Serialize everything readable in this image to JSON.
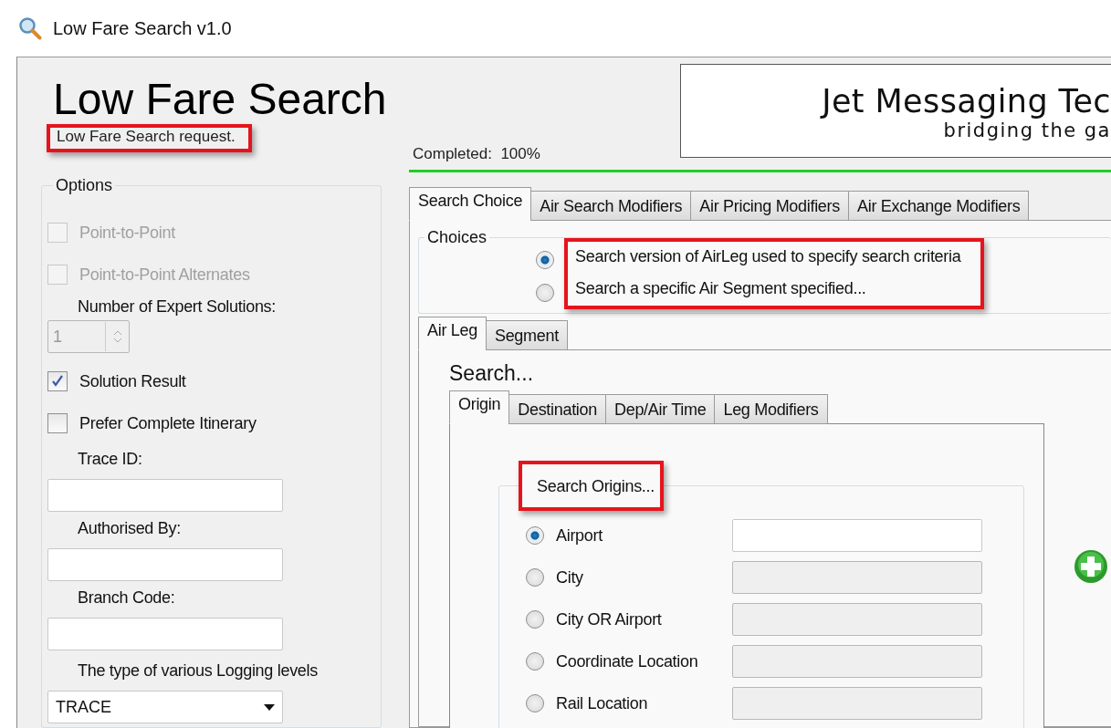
{
  "window": {
    "title": "Low Fare Search v1.0"
  },
  "header": {
    "title": "Low Fare Search",
    "subtitle": "Low Fare Search request.",
    "subtitle_highlighted": true
  },
  "options": {
    "legend": "Options",
    "items": [
      {
        "kind": "checkbox",
        "label": "Point-to-Point",
        "checked": false,
        "disabled": true
      },
      {
        "kind": "checkbox",
        "label": "Point-to-Point Alternates",
        "checked": false,
        "disabled": true
      },
      {
        "kind": "spinner",
        "label": "Number of Expert Solutions:",
        "value": "1",
        "disabled": true
      },
      {
        "kind": "checkbox",
        "label": "Solution Result",
        "checked": true,
        "disabled": false
      },
      {
        "kind": "checkbox",
        "label": "Prefer Complete Itinerary",
        "checked": false,
        "disabled": false
      },
      {
        "kind": "text",
        "label": "Trace ID:"
      },
      {
        "kind": "text",
        "label": "Authorised By:"
      },
      {
        "kind": "text",
        "label": "Branch Code:"
      },
      {
        "kind": "dropdown",
        "label": "The type of various Logging levels",
        "value": "TRACE"
      }
    ]
  },
  "progress": {
    "label": "Completed:  100%",
    "level": 1
  },
  "logo": {
    "name": "Jet Messaging Tec",
    "tagline": "bridging the ga"
  },
  "tabs": [
    {
      "label": "Search Choice",
      "selected": true
    },
    {
      "label": "Air Search Modifiers",
      "selected": false
    },
    {
      "label": "Air Pricing Modifiers",
      "selected": false
    },
    {
      "label": "Air Exchange Modifiers",
      "selected": false
    }
  ],
  "choices": {
    "legend": "Choices",
    "highlighted": true,
    "options": [
      {
        "label": "Search version of AirLeg used to specify search criteria",
        "selected": true
      },
      {
        "label": "Search a specific Air Segment specified...",
        "selected": false
      }
    ]
  },
  "leg_tabs": [
    {
      "label": "Air Leg",
      "selected": true
    },
    {
      "label": "Segment",
      "selected": false
    }
  ],
  "search": {
    "heading": "Search...",
    "tabs": [
      {
        "label": "Origin",
        "selected": true
      },
      {
        "label": "Destination",
        "selected": false
      },
      {
        "label": "Dep/Air Time",
        "selected": false
      },
      {
        "label": "Leg Modifiers",
        "selected": false
      }
    ],
    "origins": {
      "legend": "Search Origins...",
      "highlighted": true,
      "options": [
        {
          "label": "Airport",
          "selected": true
        },
        {
          "label": "City",
          "selected": false
        },
        {
          "label": "City OR Airport",
          "selected": false
        },
        {
          "label": "Coordinate Location",
          "selected": false
        },
        {
          "label": "Rail Location",
          "selected": false
        }
      ]
    }
  }
}
